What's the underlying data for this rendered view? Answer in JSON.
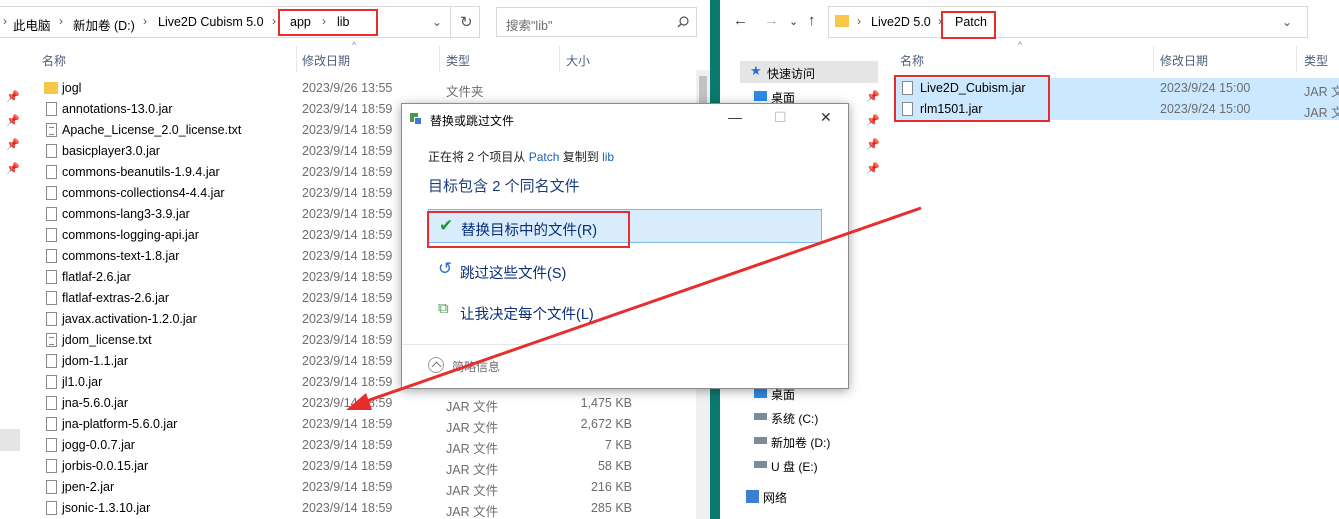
{
  "left": {
    "breadcrumb": [
      "此电脑",
      "新加卷 (D:)",
      "Live2D Cubism 5.0",
      "app",
      "lib"
    ],
    "search_placeholder": "搜索\"lib\"",
    "columns": {
      "name": "名称",
      "date": "修改日期",
      "type": "类型",
      "size": "大小"
    },
    "files": [
      {
        "name": "jogl",
        "date": "2023/9/26 13:55",
        "type": "文件夹",
        "size": "",
        "icon": "folder-icon"
      },
      {
        "name": "annotations-13.0.jar",
        "date": "2023/9/14 18:59",
        "type": "",
        "size": "",
        "icon": "file-icon"
      },
      {
        "name": "Apache_License_2.0_license.txt",
        "date": "2023/9/14 18:59",
        "type": "",
        "size": "",
        "icon": "text-file-icon"
      },
      {
        "name": "basicplayer3.0.jar",
        "date": "2023/9/14 18:59",
        "type": "",
        "size": "",
        "icon": "file-icon"
      },
      {
        "name": "commons-beanutils-1.9.4.jar",
        "date": "2023/9/14 18:59",
        "type": "",
        "size": "",
        "icon": "file-icon"
      },
      {
        "name": "commons-collections4-4.4.jar",
        "date": "2023/9/14 18:59",
        "type": "",
        "size": "",
        "icon": "file-icon"
      },
      {
        "name": "commons-lang3-3.9.jar",
        "date": "2023/9/14 18:59",
        "type": "",
        "size": "",
        "icon": "file-icon"
      },
      {
        "name": "commons-logging-api.jar",
        "date": "2023/9/14 18:59",
        "type": "",
        "size": "",
        "icon": "file-icon"
      },
      {
        "name": "commons-text-1.8.jar",
        "date": "2023/9/14 18:59",
        "type": "",
        "size": "",
        "icon": "file-icon"
      },
      {
        "name": "flatlaf-2.6.jar",
        "date": "2023/9/14 18:59",
        "type": "",
        "size": "",
        "icon": "file-icon"
      },
      {
        "name": "flatlaf-extras-2.6.jar",
        "date": "2023/9/14 18:59",
        "type": "",
        "size": "",
        "icon": "file-icon"
      },
      {
        "name": "javax.activation-1.2.0.jar",
        "date": "2023/9/14 18:59",
        "type": "",
        "size": "",
        "icon": "file-icon"
      },
      {
        "name": "jdom_license.txt",
        "date": "2023/9/14 18:59",
        "type": "",
        "size": "",
        "icon": "text-file-icon"
      },
      {
        "name": "jdom-1.1.jar",
        "date": "2023/9/14 18:59",
        "type": "",
        "size": "",
        "icon": "file-icon"
      },
      {
        "name": "jl1.0.jar",
        "date": "2023/9/14 18:59",
        "type": "",
        "size": "",
        "icon": "file-icon"
      },
      {
        "name": "jna-5.6.0.jar",
        "date": "2023/9/14 18:59",
        "type": "JAR 文件",
        "size": "1,475 KB",
        "icon": "file-icon"
      },
      {
        "name": "jna-platform-5.6.0.jar",
        "date": "2023/9/14 18:59",
        "type": "JAR 文件",
        "size": "2,672 KB",
        "icon": "file-icon"
      },
      {
        "name": "jogg-0.0.7.jar",
        "date": "2023/9/14 18:59",
        "type": "JAR 文件",
        "size": "7 KB",
        "icon": "file-icon"
      },
      {
        "name": "jorbis-0.0.15.jar",
        "date": "2023/9/14 18:59",
        "type": "JAR 文件",
        "size": "58 KB",
        "icon": "file-icon"
      },
      {
        "name": "jpen-2.jar",
        "date": "2023/9/14 18:59",
        "type": "JAR 文件",
        "size": "216 KB",
        "icon": "file-icon"
      },
      {
        "name": "jsonic-1.3.10.jar",
        "date": "2023/9/14 18:59",
        "type": "JAR 文件",
        "size": "285 KB",
        "icon": "file-icon"
      }
    ]
  },
  "right": {
    "breadcrumb": [
      "Live2D 5.0",
      "Patch"
    ],
    "columns": {
      "name": "名称",
      "date": "修改日期",
      "type": "类型"
    },
    "files": [
      {
        "name": "Live2D_Cubism.jar",
        "date": "2023/9/24 15:00",
        "type": "JAR 文"
      },
      {
        "name": "rlm1501.jar",
        "date": "2023/9/24 15:00",
        "type": "JAR 文"
      }
    ],
    "sidebar": {
      "quick_access": "快速访问",
      "desktop": "桌面",
      "desktop2": "桌面",
      "drive_c": "系统 (C:)",
      "drive_d": "新加卷 (D:)",
      "drive_e": "U 盘 (E:)",
      "network": "网络"
    }
  },
  "dialog": {
    "title": "替换或跳过文件",
    "info_prefix": "正在将 2 个项目从",
    "info_source": "Patch",
    "info_middle": "复制到",
    "info_target": "lib",
    "heading": "目标包含 2 个同名文件",
    "option_replace": "替换目标中的文件(R)",
    "option_skip": "跳过这些文件(S)",
    "option_decide": "让我决定每个文件(L)",
    "more_details": "简略信息"
  },
  "colors": {
    "highlight_red": "#e62e2e",
    "selection_blue": "#cce8ff",
    "splitter": "#0a7a6e"
  }
}
